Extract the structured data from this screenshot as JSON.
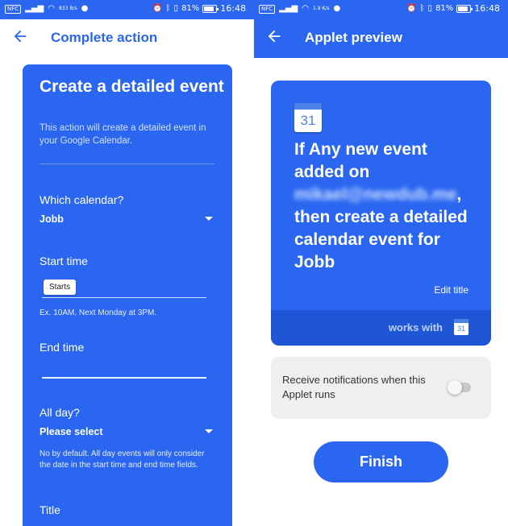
{
  "status_left": {
    "nfc": "NFC",
    "net_speed_left": "833 B/s",
    "net_speed_right": "1.9 K/s",
    "battery": "81%",
    "time": "16:48"
  },
  "left_screen": {
    "back_icon": "arrow-left-icon",
    "title": "Complete action",
    "card": {
      "heading": "Create a detailed event",
      "description": "This action will create a detailed event in your Google Calendar.",
      "calendar_label": "Which calendar?",
      "calendar_value": "Jobb",
      "start_label": "Start time",
      "start_chip": "Starts",
      "start_hint": "Ex. 10AM, Next Monday at 3PM.",
      "end_label": "End time",
      "allday_label": "All day?",
      "allday_value": "Please select",
      "allday_hint": "No by default. All day events will only consider the date in the start time and end time fields.",
      "title_label": "Title"
    }
  },
  "right_screen": {
    "back_icon": "arrow-left-icon",
    "title": "Applet preview",
    "preview": {
      "calendar_day": "31",
      "text_part1": "If Any new event added on",
      "redacted_email": "mikael@newdub.me",
      "text_part2": ", then create a detailed calendar event for Jobb",
      "edit_title": "Edit title",
      "works_with": "works with",
      "works_icon_day": "31"
    },
    "notification_text": "Receive notifications when this Applet runs",
    "notification_enabled": false,
    "finish_label": "Finish"
  },
  "colors": {
    "brand_blue": "#2a66f0",
    "band_blue": "#1f56d6",
    "card_bg": "#efefef"
  }
}
